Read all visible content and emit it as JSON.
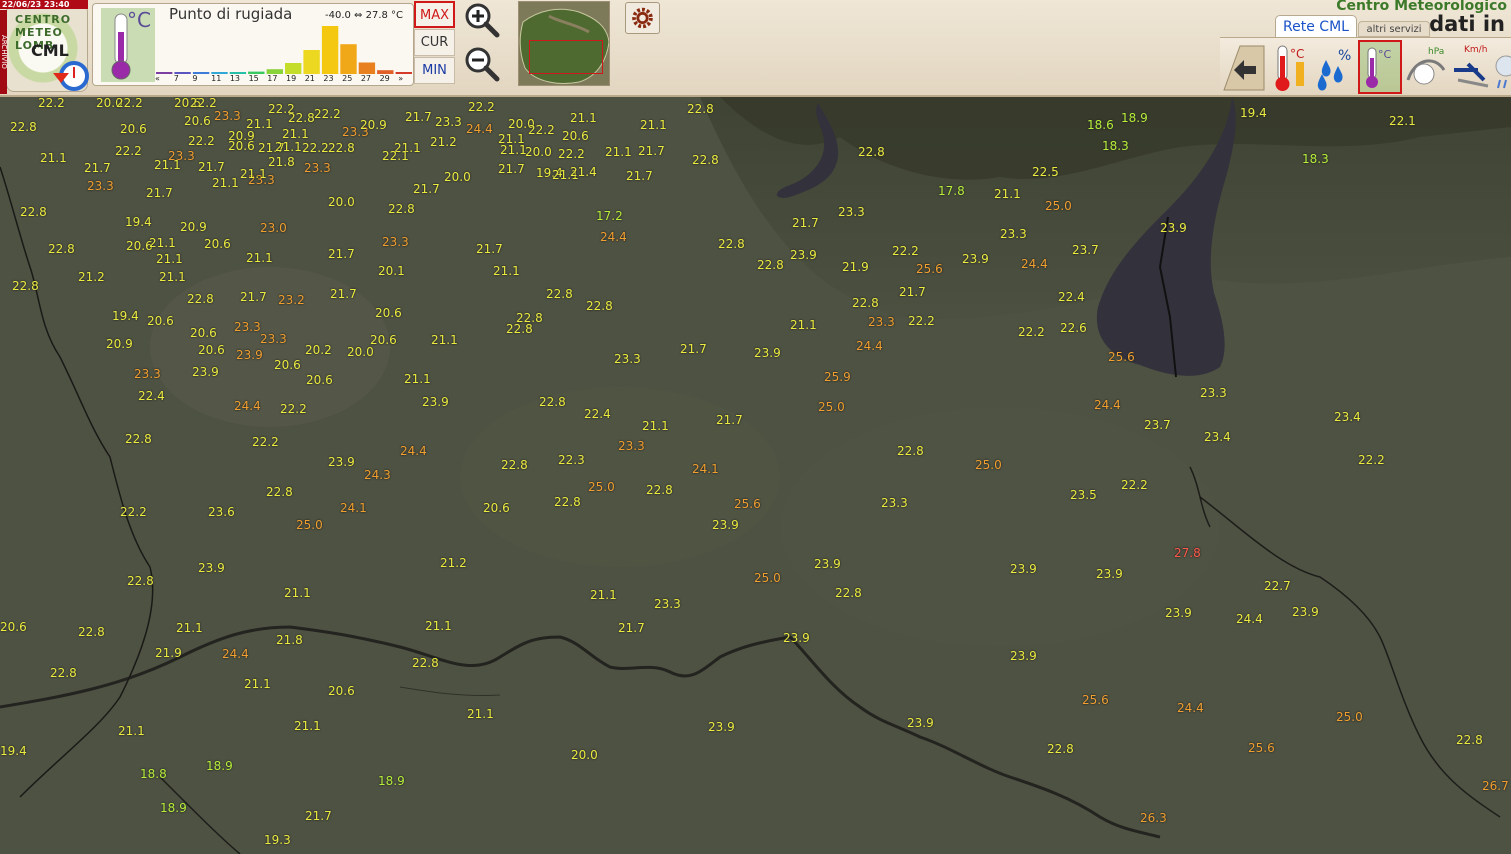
{
  "header": {
    "timestamp": "22/06/23 23:40",
    "archive_label": "ARCHIVIO",
    "logo": {
      "ring": "CENTRO METEO LOMB",
      "center": "CML"
    },
    "brand_line1": "Centro Meteorologico",
    "brand_line2": "dati in"
  },
  "legend": {
    "title": "Punto di rugiada",
    "unit": "°C",
    "range": "-40.0 ⇔ 27.8 °C",
    "ticks": [
      "«",
      "7",
      "9",
      "11",
      "13",
      "15",
      "17",
      "19",
      "21",
      "23",
      "25",
      "27",
      "29",
      "»"
    ],
    "hist_bins": [
      {
        "v": 0.01,
        "c": "#7a3fa0"
      },
      {
        "v": 0.01,
        "c": "#5a55c0"
      },
      {
        "v": 0.02,
        "c": "#3d7bd8"
      },
      {
        "v": 0.03,
        "c": "#2fa8d8"
      },
      {
        "v": 0.04,
        "c": "#26c0a8"
      },
      {
        "v": 0.05,
        "c": "#3ac860"
      },
      {
        "v": 0.1,
        "c": "#88d23a"
      },
      {
        "v": 0.23,
        "c": "#c4dc2a"
      },
      {
        "v": 0.5,
        "c": "#ecd820"
      },
      {
        "v": 1.0,
        "c": "#f4c810"
      },
      {
        "v": 0.62,
        "c": "#f0a818"
      },
      {
        "v": 0.24,
        "c": "#e88020"
      },
      {
        "v": 0.08,
        "c": "#e06028"
      },
      {
        "v": 0.03,
        "c": "#d43a2a"
      }
    ]
  },
  "modes": {
    "max": "MAX",
    "cur": "CUR",
    "min": "MIN",
    "active": "max"
  },
  "tabs": {
    "rete": "Rete CML",
    "altri": "altri servizi"
  },
  "params": {
    "temp_unit": "°C",
    "hum_unit": "%",
    "dew_unit": "°C",
    "press_unit": "hPa",
    "wind_unit": "Km/h"
  },
  "colors": {
    "green": "#b8f03a",
    "yellow": "#ecec40",
    "orange": "#f0a030",
    "red": "#ff5a4a",
    "active": "#d01818"
  },
  "stations": [
    [
      "22.2",
      38,
      97,
      "y"
    ],
    [
      "20.0",
      96,
      97,
      "y"
    ],
    [
      "22.2",
      116,
      97,
      "y"
    ],
    [
      "20.6",
      174,
      97,
      "y"
    ],
    [
      "22.2",
      190,
      97,
      "y"
    ],
    [
      "22.8",
      10,
      121,
      "y"
    ],
    [
      "20.6",
      120,
      123,
      "y"
    ],
    [
      "20.6",
      184,
      115,
      "y"
    ],
    [
      "23.3",
      214,
      110,
      "o"
    ],
    [
      "22.2",
      268,
      103,
      "y"
    ],
    [
      "22.8",
      288,
      112,
      "y"
    ],
    [
      "22.2",
      314,
      108,
      "y"
    ],
    [
      "23.3",
      342,
      126,
      "o"
    ],
    [
      "20.9",
      360,
      119,
      "y"
    ],
    [
      "21.7",
      405,
      111,
      "y"
    ],
    [
      "23.3",
      435,
      116,
      "y"
    ],
    [
      "22.2",
      468,
      101,
      "y"
    ],
    [
      "24.4",
      466,
      123,
      "o"
    ],
    [
      "20.0",
      508,
      118,
      "y"
    ],
    [
      "21.1",
      498,
      133,
      "y"
    ],
    [
      "22.2",
      528,
      124,
      "y"
    ],
    [
      "21.1",
      570,
      112,
      "y"
    ],
    [
      "20.6",
      562,
      130,
      "y"
    ],
    [
      "21.1",
      640,
      119,
      "y"
    ],
    [
      "22.8",
      687,
      103,
      "y"
    ],
    [
      "21.1",
      40,
      152,
      "y"
    ],
    [
      "22.2",
      115,
      145,
      "y"
    ],
    [
      "21.7",
      84,
      162,
      "y"
    ],
    [
      "23.3",
      168,
      150,
      "o"
    ],
    [
      "21.1",
      154,
      159,
      "y"
    ],
    [
      "22.2",
      188,
      135,
      "y"
    ],
    [
      "20.9",
      228,
      130,
      "y"
    ],
    [
      "21.1",
      246,
      118,
      "y"
    ],
    [
      "21.1",
      282,
      128,
      "y"
    ],
    [
      "20.6",
      228,
      140,
      "y"
    ],
    [
      "21.7",
      258,
      142,
      "y"
    ],
    [
      "21.1",
      275,
      141,
      "y"
    ],
    [
      "22.2",
      302,
      142,
      "y"
    ],
    [
      "22.8",
      328,
      142,
      "y"
    ],
    [
      "21.8",
      268,
      156,
      "y"
    ],
    [
      "23.3",
      304,
      162,
      "o"
    ],
    [
      "21.1",
      394,
      142,
      "y"
    ],
    [
      "22.1",
      382,
      150,
      "y"
    ],
    [
      "21.2",
      430,
      136,
      "y"
    ],
    [
      "21.1",
      500,
      144,
      "y"
    ],
    [
      "20.0",
      525,
      146,
      "y"
    ],
    [
      "22.2",
      558,
      148,
      "y"
    ],
    [
      "21.1",
      605,
      146,
      "y"
    ],
    [
      "21.7",
      638,
      145,
      "y"
    ],
    [
      "22.8",
      692,
      154,
      "y"
    ],
    [
      "22.8",
      858,
      146,
      "y"
    ],
    [
      "23.3",
      87,
      180,
      "o"
    ],
    [
      "21.7",
      198,
      161,
      "y"
    ],
    [
      "21.1",
      212,
      177,
      "y"
    ],
    [
      "23.3",
      248,
      174,
      "o"
    ],
    [
      "21.1",
      240,
      168,
      "y"
    ],
    [
      "20.0",
      444,
      171,
      "y"
    ],
    [
      "21.7",
      498,
      163,
      "y"
    ],
    [
      "19.4",
      536,
      167,
      "y"
    ],
    [
      "21.1",
      552,
      169,
      "y"
    ],
    [
      "21.4",
      570,
      166,
      "y"
    ],
    [
      "21.7",
      626,
      170,
      "y"
    ],
    [
      "21.7",
      146,
      187,
      "y"
    ],
    [
      "21.7",
      413,
      183,
      "y"
    ],
    [
      "20.0",
      328,
      196,
      "y"
    ],
    [
      "22.8",
      388,
      203,
      "y"
    ],
    [
      "22.8",
      20,
      206,
      "y"
    ],
    [
      "19.4",
      125,
      216,
      "y"
    ],
    [
      "20.9",
      180,
      221,
      "y"
    ],
    [
      "23.0",
      260,
      222,
      "o"
    ],
    [
      "17.2",
      596,
      210,
      "g"
    ],
    [
      "24.4",
      600,
      231,
      "o"
    ],
    [
      "21.7",
      792,
      217,
      "y"
    ],
    [
      "23.3",
      838,
      206,
      "y"
    ],
    [
      "17.8",
      938,
      185,
      "g"
    ],
    [
      "21.1",
      994,
      188,
      "y"
    ],
    [
      "22.5",
      1032,
      166,
      "y"
    ],
    [
      "25.0",
      1045,
      200,
      "o"
    ],
    [
      "23.3",
      1000,
      228,
      "y"
    ],
    [
      "23.7",
      1072,
      244,
      "y"
    ],
    [
      "23.9",
      1160,
      222,
      "y"
    ],
    [
      "19.4",
      1240,
      107,
      "y"
    ],
    [
      "18.6",
      1087,
      119,
      "g"
    ],
    [
      "18.9",
      1121,
      112,
      "g"
    ],
    [
      "18.3",
      1102,
      140,
      "g"
    ],
    [
      "18.3",
      1302,
      153,
      "g"
    ],
    [
      "22.1",
      1389,
      115,
      "y"
    ],
    [
      "22.8",
      48,
      243,
      "y"
    ],
    [
      "20.6",
      126,
      240,
      "y"
    ],
    [
      "21.1",
      149,
      237,
      "y"
    ],
    [
      "20.6",
      204,
      238,
      "y"
    ],
    [
      "21.1",
      156,
      253,
      "y"
    ],
    [
      "21.1",
      246,
      252,
      "y"
    ],
    [
      "21.7",
      328,
      248,
      "y"
    ],
    [
      "23.3",
      382,
      236,
      "o"
    ],
    [
      "21.7",
      476,
      243,
      "y"
    ],
    [
      "21.1",
      493,
      265,
      "y"
    ],
    [
      "20.1",
      378,
      265,
      "y"
    ],
    [
      "22.8",
      718,
      238,
      "y"
    ],
    [
      "23.9",
      790,
      249,
      "y"
    ],
    [
      "22.8",
      757,
      259,
      "y"
    ],
    [
      "21.9",
      842,
      261,
      "y"
    ],
    [
      "22.2",
      892,
      245,
      "y"
    ],
    [
      "25.6",
      916,
      263,
      "o"
    ],
    [
      "23.9",
      962,
      253,
      "y"
    ],
    [
      "24.4",
      1021,
      258,
      "o"
    ],
    [
      "21.2",
      78,
      271,
      "y"
    ],
    [
      "21.1",
      159,
      271,
      "y"
    ],
    [
      "22.8",
      12,
      280,
      "y"
    ],
    [
      "22.8",
      187,
      293,
      "y"
    ],
    [
      "21.7",
      240,
      291,
      "y"
    ],
    [
      "23.2",
      278,
      294,
      "o"
    ],
    [
      "21.7",
      330,
      288,
      "y"
    ],
    [
      "22.8",
      546,
      288,
      "y"
    ],
    [
      "22.8",
      586,
      300,
      "y"
    ],
    [
      "22.8",
      852,
      297,
      "y"
    ],
    [
      "21.7",
      899,
      286,
      "y"
    ],
    [
      "23.3",
      868,
      316,
      "o"
    ],
    [
      "22.2",
      908,
      315,
      "y"
    ],
    [
      "22.4",
      1058,
      291,
      "y"
    ],
    [
      "22.2",
      1018,
      326,
      "y"
    ],
    [
      "22.6",
      1060,
      322,
      "y"
    ],
    [
      "19.4",
      112,
      310,
      "y"
    ],
    [
      "20.6",
      147,
      315,
      "y"
    ],
    [
      "23.3",
      234,
      321,
      "o"
    ],
    [
      "20.6",
      190,
      327,
      "y"
    ],
    [
      "23.3",
      260,
      333,
      "o"
    ],
    [
      "20.6",
      375,
      307,
      "y"
    ],
    [
      "22.8",
      516,
      312,
      "y"
    ],
    [
      "22.8",
      506,
      323,
      "y"
    ],
    [
      "21.1",
      790,
      319,
      "y"
    ],
    [
      "20.9",
      106,
      338,
      "y"
    ],
    [
      "20.6",
      198,
      344,
      "y"
    ],
    [
      "23.9",
      236,
      349,
      "o"
    ],
    [
      "20.2",
      305,
      344,
      "y"
    ],
    [
      "20.0",
      347,
      346,
      "y"
    ],
    [
      "20.6",
      370,
      334,
      "y"
    ],
    [
      "21.1",
      431,
      334,
      "y"
    ],
    [
      "20.6",
      274,
      359,
      "y"
    ],
    [
      "24.4",
      856,
      340,
      "o"
    ],
    [
      "23.3",
      614,
      353,
      "y"
    ],
    [
      "21.7",
      680,
      343,
      "y"
    ],
    [
      "23.9",
      754,
      347,
      "y"
    ],
    [
      "25.6",
      1108,
      351,
      "o"
    ],
    [
      "23.3",
      134,
      368,
      "o"
    ],
    [
      "23.9",
      192,
      366,
      "y"
    ],
    [
      "20.6",
      306,
      374,
      "y"
    ],
    [
      "21.1",
      404,
      373,
      "y"
    ],
    [
      "25.9",
      824,
      371,
      "o"
    ],
    [
      "23.3",
      1200,
      387,
      "y"
    ],
    [
      "22.4",
      138,
      390,
      "y"
    ],
    [
      "23.9",
      422,
      396,
      "y"
    ],
    [
      "24.4",
      234,
      400,
      "o"
    ],
    [
      "22.2",
      280,
      403,
      "y"
    ],
    [
      "22.8",
      539,
      396,
      "y"
    ],
    [
      "25.0",
      818,
      401,
      "o"
    ],
    [
      "24.4",
      1094,
      399,
      "o"
    ],
    [
      "22.4",
      584,
      408,
      "y"
    ],
    [
      "21.1",
      642,
      420,
      "y"
    ],
    [
      "21.7",
      716,
      414,
      "y"
    ],
    [
      "23.7",
      1144,
      419,
      "y"
    ],
    [
      "23.4",
      1334,
      411,
      "y"
    ],
    [
      "22.8",
      125,
      433,
      "y"
    ],
    [
      "22.2",
      252,
      436,
      "y"
    ],
    [
      "23.3",
      618,
      440,
      "o"
    ],
    [
      "23.4",
      1204,
      431,
      "y"
    ],
    [
      "22.8",
      897,
      445,
      "y"
    ],
    [
      "24.4",
      400,
      445,
      "o"
    ],
    [
      "23.9",
      328,
      456,
      "y"
    ],
    [
      "22.3",
      558,
      454,
      "y"
    ],
    [
      "22.8",
      501,
      459,
      "y"
    ],
    [
      "24.1",
      692,
      463,
      "o"
    ],
    [
      "25.0",
      975,
      459,
      "o"
    ],
    [
      "22.2",
      1358,
      454,
      "y"
    ],
    [
      "24.3",
      364,
      469,
      "o"
    ],
    [
      "22.8",
      266,
      486,
      "y"
    ],
    [
      "25.0",
      588,
      481,
      "o"
    ],
    [
      "22.8",
      646,
      484,
      "y"
    ],
    [
      "22.2",
      1121,
      479,
      "y"
    ],
    [
      "23.5",
      1070,
      489,
      "y"
    ],
    [
      "24.1",
      340,
      502,
      "o"
    ],
    [
      "22.8",
      554,
      496,
      "y"
    ],
    [
      "25.6",
      734,
      498,
      "o"
    ],
    [
      "23.3",
      881,
      497,
      "y"
    ],
    [
      "22.2",
      120,
      506,
      "y"
    ],
    [
      "23.6",
      208,
      506,
      "y"
    ],
    [
      "20.6",
      483,
      502,
      "y"
    ],
    [
      "25.0",
      296,
      519,
      "o"
    ],
    [
      "23.9",
      712,
      519,
      "y"
    ],
    [
      "27.8",
      1174,
      547,
      "r"
    ],
    [
      "21.2",
      440,
      557,
      "y"
    ],
    [
      "23.9",
      198,
      562,
      "y"
    ],
    [
      "23.9",
      814,
      558,
      "y"
    ],
    [
      "23.9",
      1010,
      563,
      "y"
    ],
    [
      "23.9",
      1096,
      568,
      "y"
    ],
    [
      "25.0",
      754,
      572,
      "o"
    ],
    [
      "22.8",
      127,
      575,
      "y"
    ],
    [
      "22.8",
      835,
      587,
      "y"
    ],
    [
      "22.7",
      1264,
      580,
      "y"
    ],
    [
      "21.1",
      284,
      587,
      "y"
    ],
    [
      "21.1",
      590,
      589,
      "y"
    ],
    [
      "23.3",
      654,
      598,
      "y"
    ],
    [
      "23.9",
      1165,
      607,
      "y"
    ],
    [
      "23.9",
      1292,
      606,
      "y"
    ],
    [
      "24.4",
      1236,
      613,
      "y"
    ],
    [
      "20.6",
      0,
      621,
      "y"
    ],
    [
      "22.8",
      78,
      626,
      "y"
    ],
    [
      "21.1",
      176,
      622,
      "y"
    ],
    [
      "21.1",
      425,
      620,
      "y"
    ],
    [
      "21.7",
      618,
      622,
      "y"
    ],
    [
      "21.8",
      276,
      634,
      "y"
    ],
    [
      "23.9",
      783,
      632,
      "y"
    ],
    [
      "24.4",
      222,
      648,
      "o"
    ],
    [
      "21.9",
      155,
      647,
      "y"
    ],
    [
      "22.8",
      412,
      657,
      "y"
    ],
    [
      "23.9",
      1010,
      650,
      "y"
    ],
    [
      "22.8",
      50,
      667,
      "y"
    ],
    [
      "21.1",
      244,
      678,
      "y"
    ],
    [
      "20.6",
      328,
      685,
      "y"
    ],
    [
      "25.6",
      1082,
      694,
      "o"
    ],
    [
      "24.4",
      1177,
      702,
      "o"
    ],
    [
      "21.1",
      467,
      708,
      "y"
    ],
    [
      "23.9",
      907,
      717,
      "y"
    ],
    [
      "25.0",
      1336,
      711,
      "o"
    ],
    [
      "21.1",
      294,
      720,
      "y"
    ],
    [
      "23.9",
      708,
      721,
      "y"
    ],
    [
      "21.1",
      118,
      725,
      "y"
    ],
    [
      "22.8",
      1456,
      734,
      "y"
    ],
    [
      "25.6",
      1248,
      742,
      "o"
    ],
    [
      "22.8",
      1047,
      743,
      "y"
    ],
    [
      "19.4",
      0,
      745,
      "y"
    ],
    [
      "20.0",
      571,
      749,
      "y"
    ],
    [
      "18.9",
      206,
      760,
      "g"
    ],
    [
      "18.8",
      140,
      768,
      "g"
    ],
    [
      "18.9",
      378,
      775,
      "g"
    ],
    [
      "26.7",
      1482,
      780,
      "o"
    ],
    [
      "18.9",
      160,
      802,
      "g"
    ],
    [
      "21.7",
      305,
      810,
      "y"
    ],
    [
      "26.3",
      1140,
      812,
      "o"
    ],
    [
      "19.3",
      264,
      834,
      "y"
    ]
  ]
}
